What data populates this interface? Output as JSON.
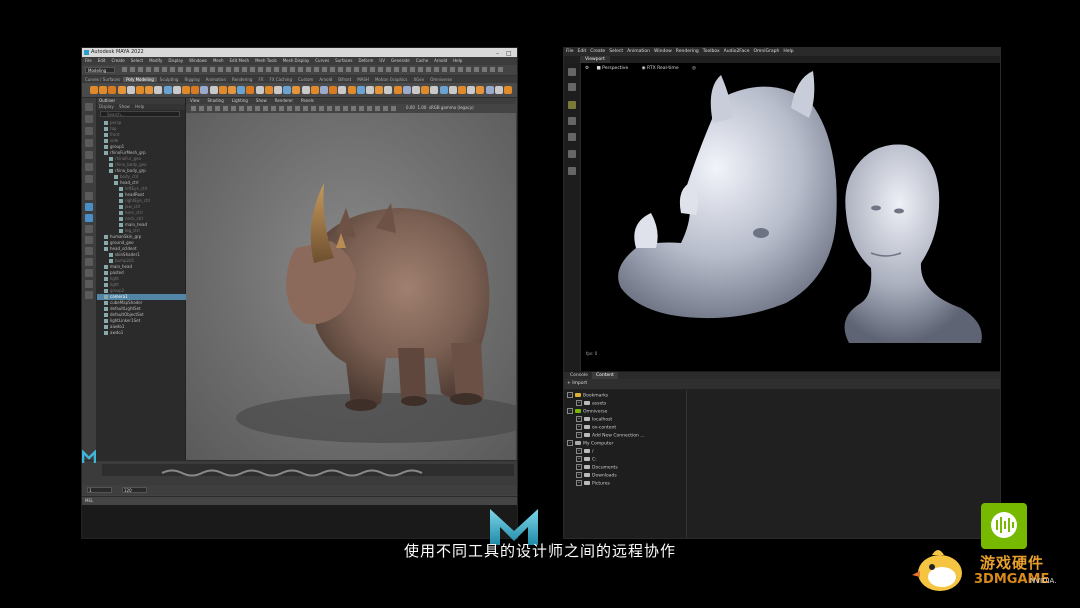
{
  "maya": {
    "title": "Autodesk MAYA 2022",
    "menu": [
      "File",
      "Edit",
      "Create",
      "Select",
      "Modify",
      "Display",
      "Windows",
      "Mesh",
      "Edit Mesh",
      "Mesh Tools",
      "Mesh Display",
      "Curves",
      "Surfaces",
      "Deform",
      "UV",
      "Generate",
      "Cache",
      "Arnold",
      "Help"
    ],
    "mode": "Modeling",
    "shelf_tabs": [
      "Curves / Surfaces",
      "Poly Modeling",
      "Sculpting",
      "Rigging",
      "Animation",
      "Rendering",
      "FX",
      "FX Caching",
      "Custom",
      "Arnold",
      "Bifrost",
      "MASH",
      "Motion Graphics",
      "XGen",
      "Omniverse"
    ],
    "active_shelf_tab": 1,
    "outliner": {
      "header": [
        "Outliner"
      ],
      "menu": [
        "Display",
        "Show",
        "Help"
      ],
      "search_placeholder": "Search...",
      "items": [
        {
          "label": "persp",
          "indent": 1,
          "style": "dim"
        },
        {
          "label": "top",
          "indent": 1,
          "style": "dim"
        },
        {
          "label": "front",
          "indent": 1,
          "style": "dim"
        },
        {
          "label": "side",
          "indent": 1,
          "style": "dim"
        },
        {
          "label": "group1",
          "indent": 1,
          "style": ""
        },
        {
          "label": "rhinoFurMesh_grp",
          "indent": 1,
          "style": ""
        },
        {
          "label": "rhinoFur_geo",
          "indent": 2,
          "style": "dim"
        },
        {
          "label": "rhino_body_geo",
          "indent": 2,
          "style": "dim"
        },
        {
          "label": "rhino_body_grp",
          "indent": 2,
          "style": ""
        },
        {
          "label": "body_ctrl",
          "indent": 3,
          "style": "dim"
        },
        {
          "label": "head_ctrl",
          "indent": 3,
          "style": ""
        },
        {
          "label": "leftEye_ctrl",
          "indent": 4,
          "style": "dim"
        },
        {
          "label": "headRoot",
          "indent": 4,
          "style": ""
        },
        {
          "label": "rightEye_ctrl",
          "indent": 4,
          "style": "dim"
        },
        {
          "label": "jaw_ctrl",
          "indent": 4,
          "style": "dim"
        },
        {
          "label": "horn_ctrl",
          "indent": 4,
          "style": "dim"
        },
        {
          "label": "neck_ctrl",
          "indent": 4,
          "style": "dim"
        },
        {
          "label": "main_head",
          "indent": 4,
          "style": ""
        },
        {
          "label": "leg_ctrl",
          "indent": 4,
          "style": "dim"
        },
        {
          "label": "humanSkin_grp",
          "indent": 1,
          "style": ""
        },
        {
          "label": "ground_geo",
          "indent": 1,
          "style": ""
        },
        {
          "label": "head_scIdent",
          "indent": 1,
          "style": ""
        },
        {
          "label": "skinShader1",
          "indent": 2,
          "style": ""
        },
        {
          "label": "bump2d1",
          "indent": 2,
          "style": "dim"
        },
        {
          "label": "main_head",
          "indent": 1,
          "style": ""
        },
        {
          "label": "pasted",
          "indent": 1,
          "style": ""
        },
        {
          "label": "light",
          "indent": 1,
          "style": "dim"
        },
        {
          "label": "light",
          "indent": 1,
          "style": "dim"
        },
        {
          "label": "group2",
          "indent": 1,
          "style": "dim"
        },
        {
          "label": "camera1",
          "indent": 1,
          "style": "sel"
        },
        {
          "label": "cubeMapShader",
          "indent": 1,
          "style": ""
        },
        {
          "label": "defaultLightSet",
          "indent": 1,
          "style": ""
        },
        {
          "label": "defaultObjectSet",
          "indent": 1,
          "style": ""
        },
        {
          "label": "lightLinker1Set",
          "indent": 1,
          "style": ""
        },
        {
          "label": "aiwdo1",
          "indent": 1,
          "style": ""
        },
        {
          "label": "awdo1",
          "indent": 1,
          "style": ""
        }
      ]
    },
    "viewport": {
      "menu": [
        "View",
        "Shading",
        "Lighting",
        "Show",
        "Renderer",
        "Panels"
      ],
      "fields": [
        "0.00",
        "1.00",
        "sRGB gamma (legacy)"
      ]
    },
    "range": {
      "start": "1",
      "end": "120"
    },
    "cmd_label": "MEL"
  },
  "omniverse": {
    "menu": [
      "File",
      "Edit",
      "Create",
      "Select",
      "Animation",
      "Window",
      "Rendering",
      "Toolbox",
      "Audio2Face",
      "OmniGraph",
      "Help"
    ],
    "tab": "Viewport",
    "viewport_header": [
      "Perspective",
      "RTX Real-time"
    ],
    "axis": "fps: 0",
    "lower_tabs": [
      "Console",
      "Content"
    ],
    "active_lower_tab": 1,
    "import_label": "+ Import",
    "tree": [
      {
        "label": "Bookmarks",
        "indent": 0,
        "color": "#e0b030"
      },
      {
        "label": "assets",
        "indent": 1,
        "color": "#bbbbbb"
      },
      {
        "label": "Omniverse",
        "indent": 0,
        "color": "#76b900"
      },
      {
        "label": "localhost",
        "indent": 1,
        "color": "#bbbbbb"
      },
      {
        "label": "ov-content",
        "indent": 1,
        "color": "#bbbbbb"
      },
      {
        "label": "Add New Connection ...",
        "indent": 1,
        "color": "#bbbbbb"
      },
      {
        "label": "My Computer",
        "indent": 0,
        "color": "#aaaaaa"
      },
      {
        "label": "/",
        "indent": 1,
        "color": "#bbbbbb"
      },
      {
        "label": "C:",
        "indent": 1,
        "color": "#bbbbbb"
      },
      {
        "label": "Documents",
        "indent": 1,
        "color": "#bbbbbb"
      },
      {
        "label": "Downloads",
        "indent": 1,
        "color": "#bbbbbb"
      },
      {
        "label": "Pictures",
        "indent": 1,
        "color": "#bbbbbb"
      }
    ]
  },
  "subtitle": "使用不同工具的设计师之间的远程协作",
  "watermark": {
    "line1": "游戏硬件",
    "line2": "3DMGAME",
    "brand": "NVIDIA."
  },
  "colors": {
    "nvidia_green": "#76b900",
    "maya_select": "#5285a6"
  }
}
